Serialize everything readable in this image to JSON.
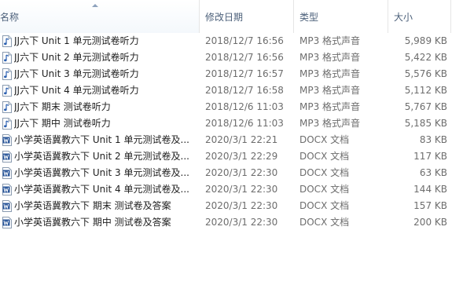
{
  "columns": {
    "name": "名称",
    "date": "修改日期",
    "type": "类型",
    "size": "大小"
  },
  "icons": {
    "mp3": "audio-file-icon",
    "docx": "word-document-icon"
  },
  "colors": {
    "header_text": "#4c607a",
    "muted_text": "#6d6d6d",
    "word_blue": "#2b579a"
  },
  "files": [
    {
      "name": "JJ六下 Unit 1 单元测试卷听力",
      "date": "2018/12/7 16:56",
      "type": "MP3 格式声音",
      "size": "5,989 KB",
      "kind": "mp3"
    },
    {
      "name": "JJ六下 Unit 2 单元测试卷听力",
      "date": "2018/12/7 16:56",
      "type": "MP3 格式声音",
      "size": "5,422 KB",
      "kind": "mp3"
    },
    {
      "name": "JJ六下 Unit 3 单元测试卷听力",
      "date": "2018/12/7 16:57",
      "type": "MP3 格式声音",
      "size": "5,576 KB",
      "kind": "mp3"
    },
    {
      "name": "JJ六下 Unit 4 单元测试卷听力",
      "date": "2018/12/7 16:58",
      "type": "MP3 格式声音",
      "size": "5,112 KB",
      "kind": "mp3"
    },
    {
      "name": "JJ六下 期末 测试卷听力",
      "date": "2018/12/6 11:03",
      "type": "MP3 格式声音",
      "size": "5,767 KB",
      "kind": "mp3"
    },
    {
      "name": "JJ六下 期中 测试卷听力",
      "date": "2018/12/6 11:03",
      "type": "MP3 格式声音",
      "size": "5,185 KB",
      "kind": "mp3"
    },
    {
      "name": "小学英语冀教六下 Unit 1 单元测试卷及...",
      "date": "2020/3/1 22:21",
      "type": "DOCX 文档",
      "size": "83 KB",
      "kind": "docx"
    },
    {
      "name": "小学英语冀教六下 Unit 2 单元测试卷及...",
      "date": "2020/3/1 22:29",
      "type": "DOCX 文档",
      "size": "117 KB",
      "kind": "docx"
    },
    {
      "name": "小学英语冀教六下 Unit 3 单元测试卷及...",
      "date": "2020/3/1 22:30",
      "type": "DOCX 文档",
      "size": "63 KB",
      "kind": "docx"
    },
    {
      "name": "小学英语冀教六下 Unit 4 单元测试卷及...",
      "date": "2020/3/1 22:30",
      "type": "DOCX 文档",
      "size": "144 KB",
      "kind": "docx"
    },
    {
      "name": "小学英语冀教六下 期末 测试卷及答案",
      "date": "2020/3/1 22:30",
      "type": "DOCX 文档",
      "size": "157 KB",
      "kind": "docx"
    },
    {
      "name": "小学英语冀教六下 期中 测试卷及答案",
      "date": "2020/3/1 22:30",
      "type": "DOCX 文档",
      "size": "200 KB",
      "kind": "docx"
    }
  ]
}
